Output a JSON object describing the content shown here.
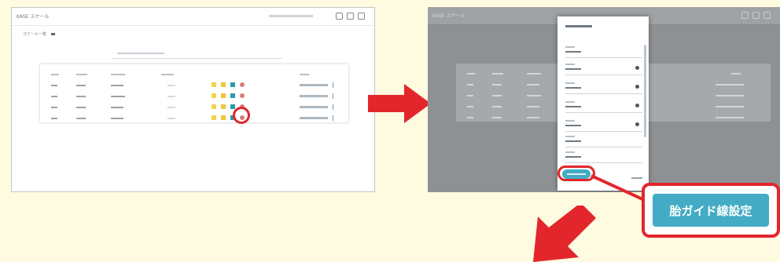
{
  "left_screen": {
    "app_title": "KASE スケール",
    "app_title_accent": "",
    "breadcrumb": [
      "スケール一覧",
      ""
    ],
    "rows": 4
  },
  "right_screen": {
    "app_title": "KASE スケール",
    "dialog_title": ""
  },
  "callout": {
    "button_label": "胎ガイド線設定"
  },
  "colors": {
    "background": "#fffbe0",
    "highlight_red": "#e3262c",
    "button_teal": "#43acc4",
    "overlay_gray": "#8e9194"
  }
}
